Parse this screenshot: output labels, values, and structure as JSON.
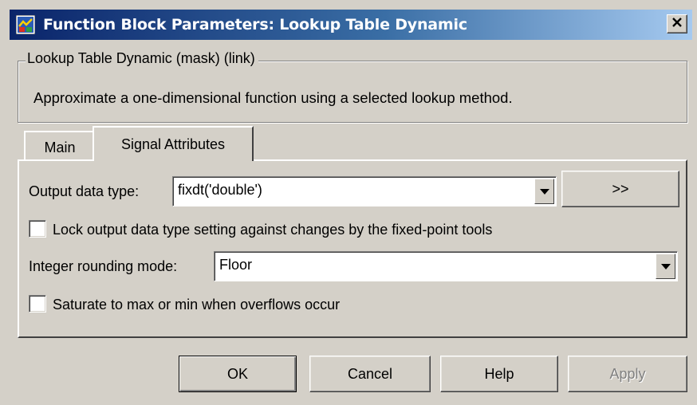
{
  "window": {
    "title": "Function Block Parameters: Lookup Table Dynamic",
    "title_icon": "simulink-block-icon",
    "close_label": "×"
  },
  "description_group": {
    "legend": "Lookup Table Dynamic (mask) (link)",
    "text": "Approximate a one-dimensional function using a selected lookup method."
  },
  "tabs": [
    {
      "label": "Main",
      "selected": false
    },
    {
      "label": "Signal Attributes",
      "selected": true
    }
  ],
  "signal_attributes": {
    "output_data_type": {
      "label": "Output data type:",
      "value": "fixdt('double')",
      "assistant_button_label": ">>"
    },
    "lock_output_checkbox": {
      "label": "Lock output data type setting against changes by the fixed-point tools",
      "checked": false
    },
    "integer_rounding_mode": {
      "label": "Integer rounding mode:",
      "value": "Floor"
    },
    "saturate_checkbox": {
      "label": "Saturate to max or min when overflows occur",
      "checked": false
    }
  },
  "buttons": {
    "ok": "OK",
    "cancel": "Cancel",
    "help": "Help",
    "apply": "Apply"
  },
  "colors": {
    "dialog_background": "#d4d0c8",
    "titlebar_start": "#0a246a",
    "titlebar_end": "#a6caf0",
    "title_text": "#ffffff",
    "disabled_text": "#808080"
  }
}
